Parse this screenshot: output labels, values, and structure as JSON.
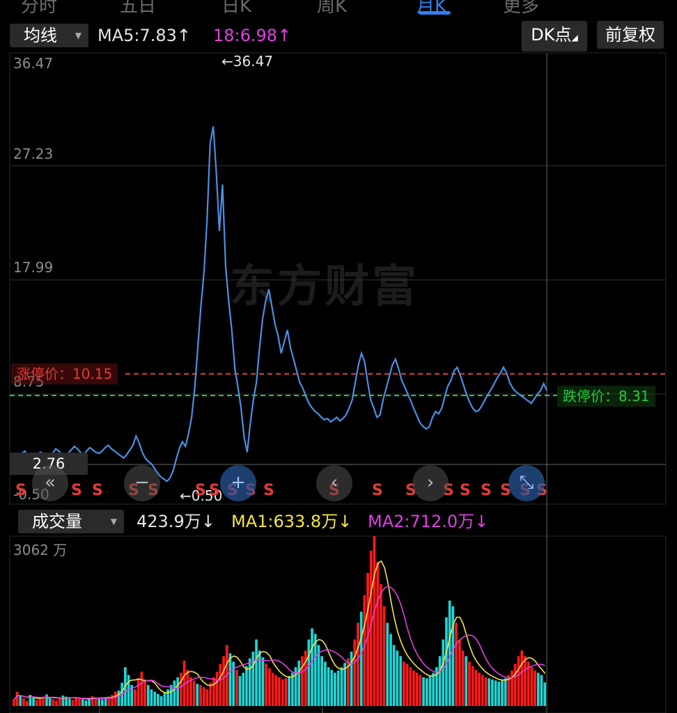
{
  "top_tabs": [
    "分时",
    "五日",
    "日K",
    "周K",
    "月K",
    "更多"
  ],
  "indicator_panel": {
    "selector_label": "均线",
    "ma5": "MA5:7.83",
    "ma5_arrow": "↑",
    "ma18": "18:6.98",
    "ma18_arrow": "↑",
    "dk_button": "DK点",
    "adjust_button": "前复权"
  },
  "price_axis": [
    "36.47",
    "27.23",
    "17.99",
    "8.75",
    "-0.50"
  ],
  "annotations": {
    "max_label": "←36.47",
    "min_label": "←0.50",
    "limit_up": "涨停价：10.15",
    "limit_down": "跌停价：8.31",
    "current_price": "2.76"
  },
  "watermark": "东方财富",
  "signals": [
    "S",
    "S",
    "S",
    "S",
    "S",
    "S",
    "S",
    "S",
    "S",
    "S",
    "S",
    "S",
    "S",
    "S",
    "S",
    "S",
    "S",
    "S",
    "S",
    "S",
    "S"
  ],
  "volume_panel": {
    "selector_label": "成交量",
    "volume": "423.9万",
    "volume_arrow": "↓",
    "ma1": "MA1:633.8万",
    "ma1_arrow": "↓",
    "ma2": "MA2:712.0万",
    "ma2_arrow": "↓",
    "axis_max": "3062 万"
  },
  "colors": {
    "price_line": "#4a90e2",
    "up_bar": "#ff1a1a",
    "down_bar": "#21d4d4",
    "ma1": "#f5e642",
    "ma2": "#e040e0",
    "limit_up": "#e53935",
    "limit_down": "#27c93f"
  },
  "icons": [
    "left-chevron-icon",
    "right-chevron-icon",
    "zoom-in-icon",
    "zoom-out-icon",
    "fullscreen-icon"
  ],
  "chart_data": {
    "type": "line",
    "ylim": [
      -0.5,
      36.47
    ],
    "price_series": [
      2.6,
      2.8,
      2.5,
      2.9,
      3.1,
      2.7,
      2.4,
      2.6,
      2.8,
      3.0,
      2.9,
      2.5,
      2.7,
      2.9,
      3.3,
      3.1,
      2.8,
      2.6,
      2.9,
      3.2,
      3.5,
      3.3,
      3.0,
      2.8,
      3.1,
      3.4,
      3.2,
      3.0,
      2.9,
      3.1,
      3.4,
      3.6,
      3.3,
      3.1,
      2.9,
      2.7,
      2.5,
      2.8,
      3.2,
      3.6,
      4.4,
      3.8,
      3.0,
      2.5,
      2.2,
      2.0,
      1.6,
      1.2,
      0.9,
      0.7,
      0.5,
      0.8,
      1.4,
      2.4,
      3.3,
      3.9,
      3.5,
      4.6,
      6.0,
      8.5,
      12.0,
      15.5,
      18.5,
      23.0,
      29.5,
      31.0,
      27.0,
      22.0,
      26.0,
      19.0,
      16.0,
      13.5,
      10.2,
      8.6,
      6.8,
      4.3,
      3.0,
      5.5,
      7.5,
      9.0,
      12.0,
      14.5,
      16.0,
      17.0,
      15.5,
      14.0,
      13.0,
      11.5,
      12.5,
      13.5,
      12.0,
      11.0,
      10.0,
      9.0,
      8.5,
      7.8,
      7.2,
      6.8,
      6.5,
      6.3,
      6.0,
      5.8,
      5.9,
      5.6,
      5.8,
      6.0,
      5.7,
      5.9,
      6.2,
      6.8,
      7.5,
      9.0,
      10.5,
      11.5,
      10.8,
      9.0,
      7.5,
      6.8,
      6.0,
      6.2,
      7.5,
      8.5,
      9.5,
      10.5,
      11.0,
      10.2,
      9.2,
      8.6,
      8.0,
      7.4,
      6.7,
      6.1,
      5.5,
      5.2,
      5.0,
      5.2,
      6.0,
      6.5,
      6.3,
      6.8,
      7.8,
      8.7,
      9.2,
      10.0,
      10.3,
      9.6,
      8.8,
      8.0,
      7.3,
      6.8,
      6.5,
      6.6,
      7.0,
      7.5,
      8.0,
      8.4,
      8.9,
      9.4,
      9.8,
      10.3,
      9.8,
      9.0,
      8.5,
      8.2,
      8.0,
      7.8,
      7.6,
      7.4,
      7.2,
      7.6,
      8.0,
      8.3,
      8.9,
      8.31
    ],
    "volume_series": [
      120,
      260,
      180,
      140,
      90,
      200,
      160,
      110,
      130,
      170,
      210,
      150,
      120,
      100,
      140,
      190,
      170,
      130,
      110,
      160,
      150,
      120,
      100,
      130,
      180,
      160,
      140,
      120,
      150,
      170,
      200,
      260,
      280,
      420,
      700,
      560,
      380,
      300,
      500,
      620,
      480,
      380,
      300,
      260,
      220,
      180,
      240,
      300,
      380,
      460,
      520,
      600,
      820,
      650,
      520,
      460,
      400,
      380,
      340,
      300,
      420,
      520,
      620,
      760,
      900,
      1100,
      950,
      800,
      650,
      540,
      600,
      720,
      860,
      980,
      1200,
      1000,
      880,
      760,
      680,
      600,
      560,
      520,
      480,
      500,
      540,
      600,
      700,
      820,
      900,
      1000,
      1200,
      1400,
      1300,
      1100,
      900,
      800,
      700,
      650,
      600,
      640,
      700,
      780,
      860,
      980,
      1200,
      1500,
      1700,
      2000,
      2400,
      2800,
      3062,
      2600,
      2200,
      1800,
      1500,
      1300,
      1100,
      1000,
      900,
      800,
      760,
      700,
      640,
      600,
      560,
      520,
      500,
      540,
      600,
      700,
      900,
      1200,
      1600,
      1900,
      1800,
      1500,
      1200,
      1000,
      900,
      800,
      720,
      650,
      600,
      560,
      520,
      500,
      480,
      460,
      440,
      460,
      500,
      560,
      640,
      760,
      900,
      1000,
      900,
      800,
      700,
      640,
      600,
      560,
      424
    ]
  }
}
